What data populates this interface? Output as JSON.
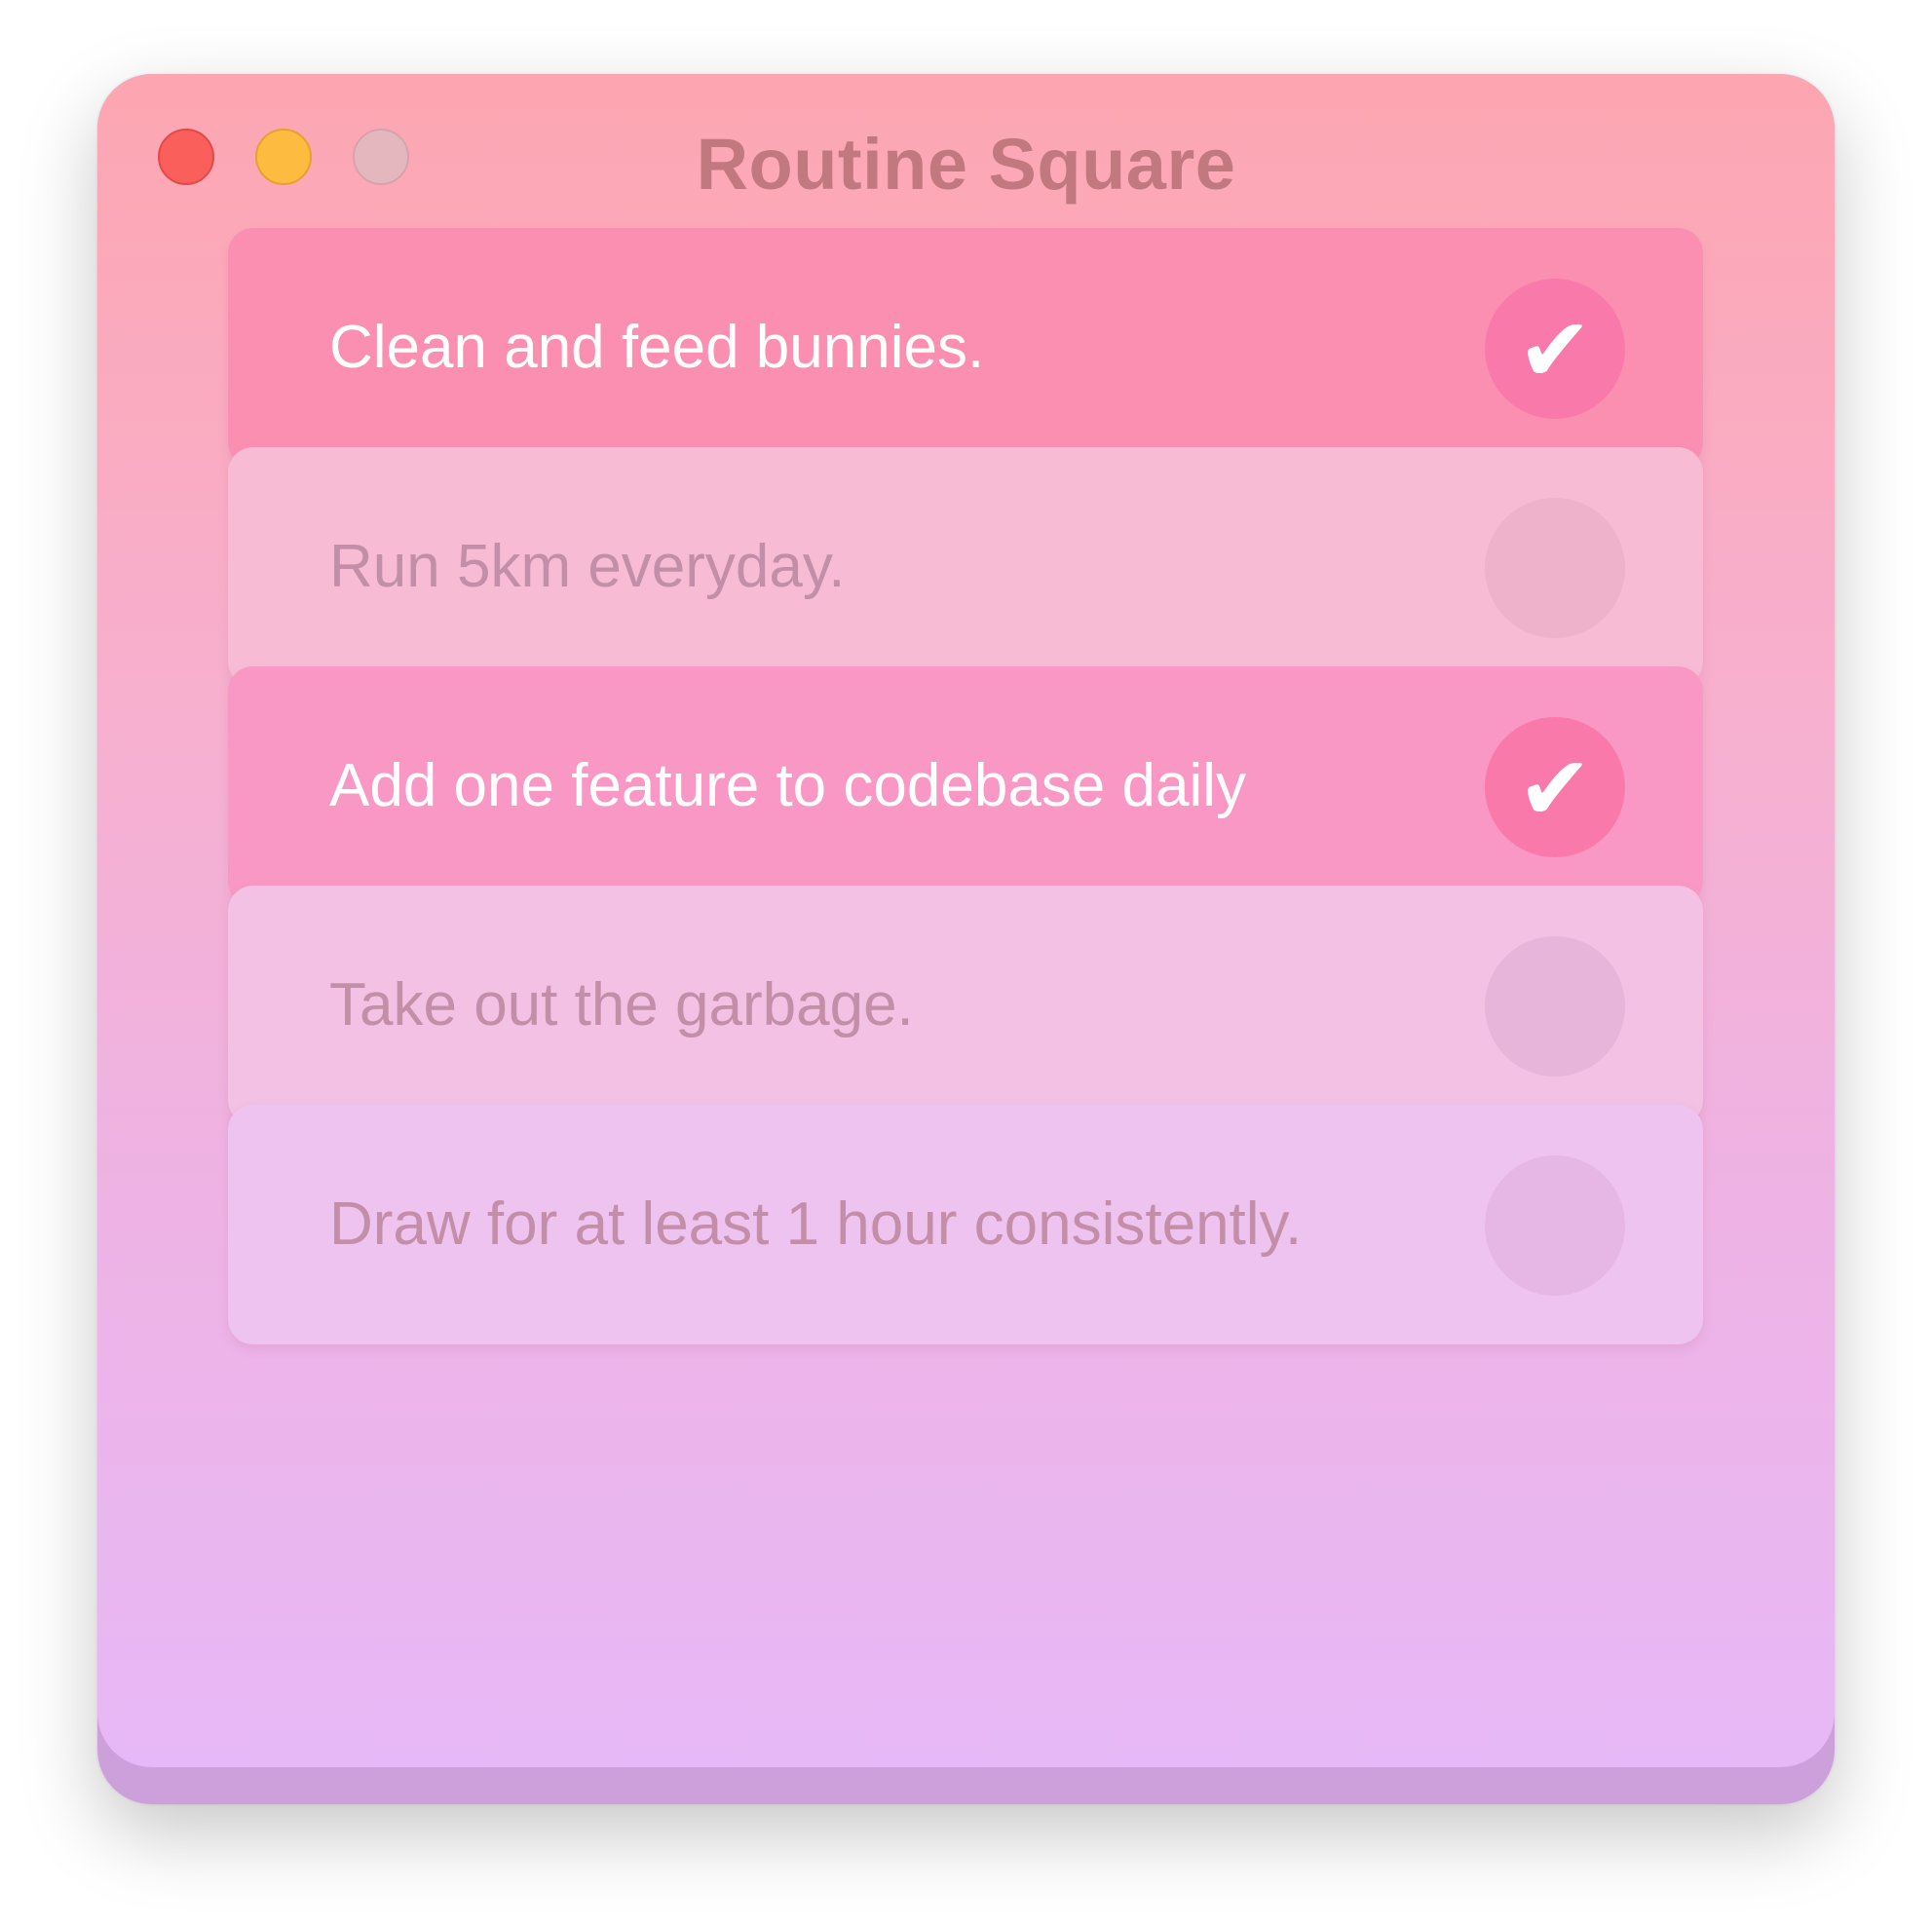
{
  "window": {
    "title": "Routine Square",
    "controls": [
      "close",
      "minimize",
      "zoom"
    ]
  },
  "colors": {
    "title_text": "#c2787f",
    "done_background": "#fb8fb2",
    "check_circle": "#f97aaa",
    "todo_text": "#c38ea8"
  },
  "tasks": [
    {
      "label": "Clean and feed bunnies.",
      "done": true,
      "check_icon": "✔"
    },
    {
      "label": "Run 5km everyday.",
      "done": false,
      "check_icon": ""
    },
    {
      "label": "Add one feature to codebase daily",
      "done": true,
      "check_icon": "✔"
    },
    {
      "label": "Take out the garbage.",
      "done": false,
      "check_icon": ""
    },
    {
      "label": "Draw for at least 1 hour consistently.",
      "done": false,
      "check_icon": ""
    }
  ]
}
